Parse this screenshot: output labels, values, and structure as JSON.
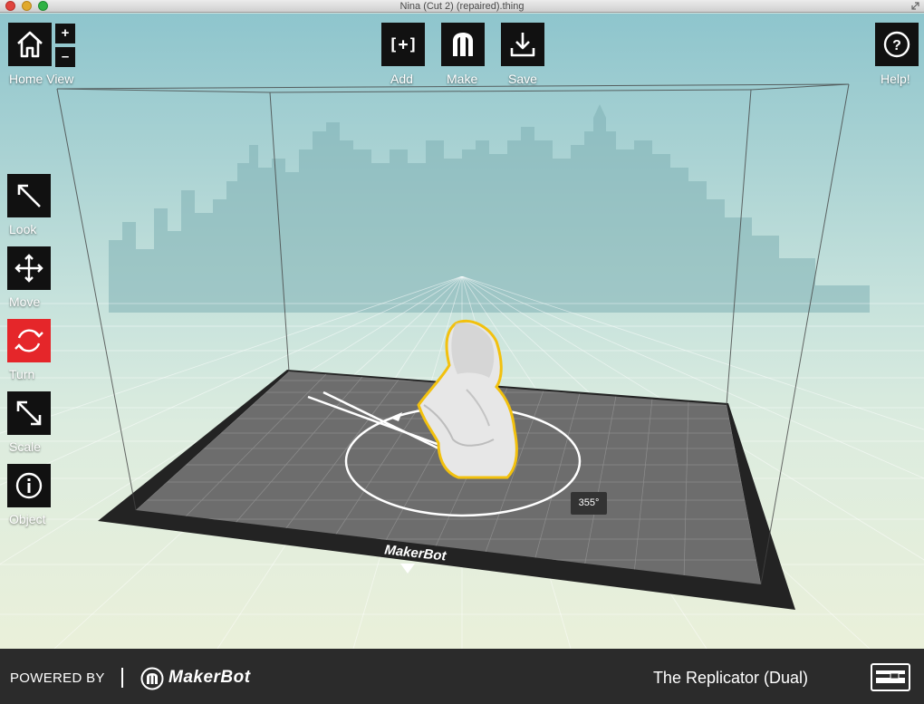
{
  "window": {
    "title": "Nina (Cut 2) (repaired).thing"
  },
  "toolbar": {
    "home_label": "Home View",
    "zoom_in": "+",
    "zoom_out": "–",
    "add_label": "Add",
    "add_glyph": "[+]",
    "make_label": "Make",
    "save_label": "Save",
    "help_label": "Help!"
  },
  "side_tools": [
    {
      "label": "Look",
      "icon": "look-arrow-icon",
      "active": false
    },
    {
      "label": "Move",
      "icon": "move-cross-icon",
      "active": false
    },
    {
      "label": "Turn",
      "icon": "turn-rotate-icon",
      "active": true
    },
    {
      "label": "Scale",
      "icon": "scale-arrow-icon",
      "active": false
    },
    {
      "label": "Object",
      "icon": "info-icon",
      "active": false
    }
  ],
  "scene": {
    "angle_readout": "355°",
    "plate_brand": "MakerBot"
  },
  "footer": {
    "powered_by": "POWERED BY",
    "brand": "MakerBot",
    "printer_name": "The Replicator (Dual)"
  },
  "colors": {
    "active_tool": "#e5262a",
    "selection_outline": "#f2c10e",
    "tool_bg": "#111111",
    "footer_bg": "#2b2b2b"
  }
}
